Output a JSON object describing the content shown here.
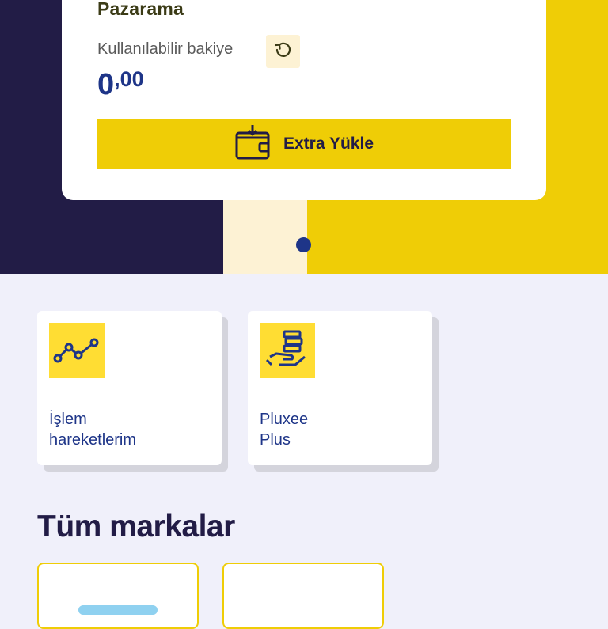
{
  "wallet_card": {
    "title": "Pazarama",
    "balance_label": "Kullanılabilir bakiye",
    "balance_integer": "0",
    "balance_decimal": ",00",
    "load_button_label": "Extra Yükle",
    "refresh_icon": "refresh-icon",
    "load_icon": "wallet-download-icon"
  },
  "carousel": {
    "active_page": 1,
    "page_count": 1
  },
  "quick_actions": [
    {
      "label_line1": "İşlem",
      "label_line2": "hareketlerim",
      "icon": "line-chart-icon"
    },
    {
      "label_line1": "Pluxee",
      "label_line2": "Plus",
      "icon": "coins-hand-icon"
    }
  ],
  "brands_section": {
    "title": "Tüm markalar"
  },
  "colors": {
    "navy": "#221c46",
    "yellow": "#efcd06",
    "cream": "#fdf2d4",
    "blue": "#1e3588",
    "background": "#f0f0fa"
  }
}
